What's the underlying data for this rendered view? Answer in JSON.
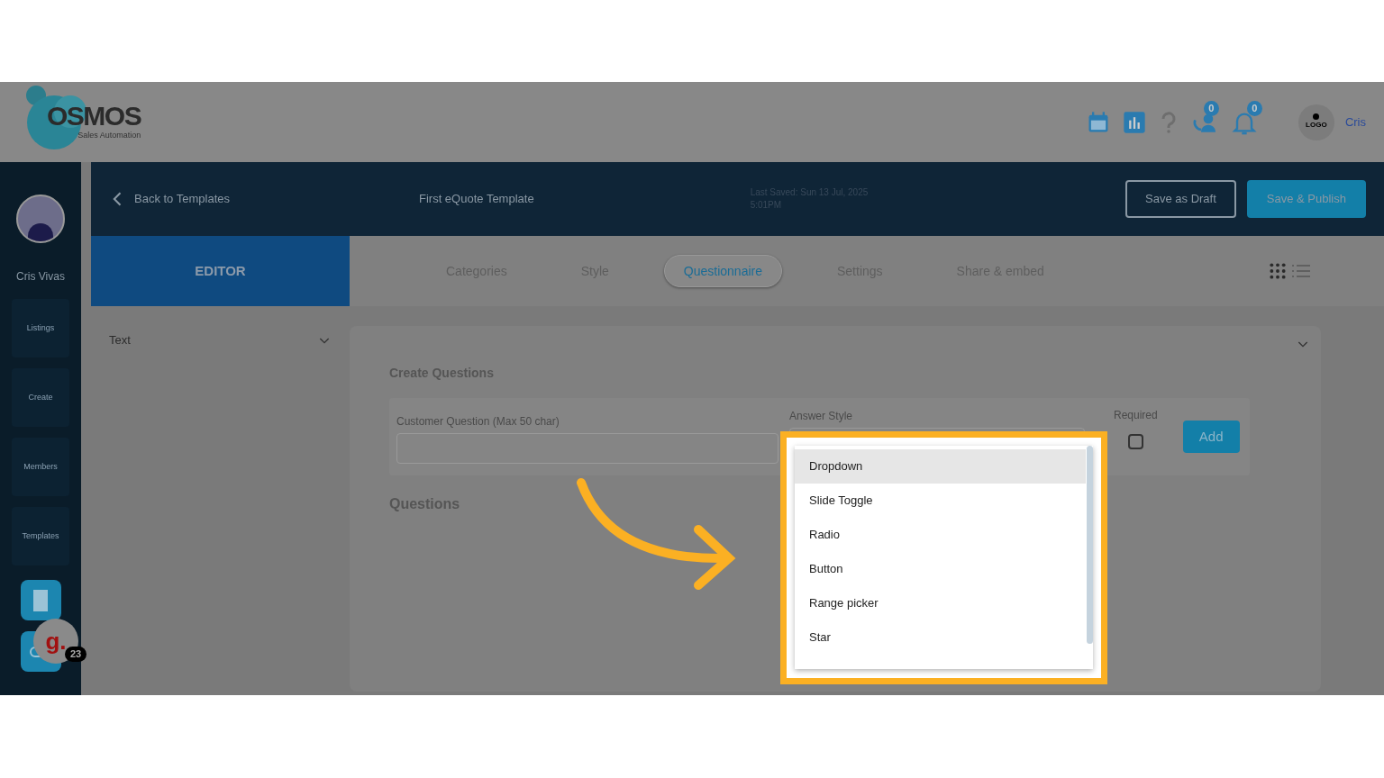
{
  "header": {
    "logo": {
      "name": "OSMOS",
      "tagline": "Sales Automation"
    },
    "badges": [
      {
        "count": "0"
      },
      {
        "count": "0"
      }
    ],
    "company_logo": "LOGO",
    "user": "Cris"
  },
  "sidebar": {
    "user_name": "Cris Vivas",
    "items": [
      {
        "label": "Listings"
      },
      {
        "label": "Create"
      },
      {
        "label": "Members"
      },
      {
        "label": "Templates"
      }
    ],
    "chat_widget": {
      "label": "g.",
      "count": "23"
    }
  },
  "top_bar": {
    "back": "Back to Templates",
    "template_name": "First eQuote Template",
    "last_saved": "Last Saved: Sun 13 Jul, 2025 5:01PM",
    "buttons": [
      {
        "label": "Save as Draft",
        "kind": "outline"
      },
      {
        "label": "Save & Publish",
        "kind": "primary"
      }
    ]
  },
  "editor_tab": {
    "label": "EDITOR",
    "selected": true
  },
  "tabs": [
    {
      "label": "Categories",
      "selected": false
    },
    {
      "label": "Style",
      "selected": false
    },
    {
      "label": "Questionnaire",
      "selected": true
    },
    {
      "label": "Settings",
      "selected": false
    },
    {
      "label": "Share & embed",
      "selected": false
    }
  ],
  "left_panel": {
    "section": "Text"
  },
  "create_questions": {
    "title": "Create Questions",
    "question_label": "Customer Question (Max 50 char)",
    "answer_label": "Answer Style",
    "required_label": "Required",
    "required_checked": false,
    "add": "Add"
  },
  "questions_title": "Questions",
  "answer_options": [
    {
      "label": "Dropdown",
      "selected": true
    },
    {
      "label": "Slide Toggle",
      "selected": false
    },
    {
      "label": "Radio",
      "selected": false
    },
    {
      "label": "Button",
      "selected": false
    },
    {
      "label": "Range picker",
      "selected": false
    },
    {
      "label": "Star",
      "selected": false
    }
  ]
}
